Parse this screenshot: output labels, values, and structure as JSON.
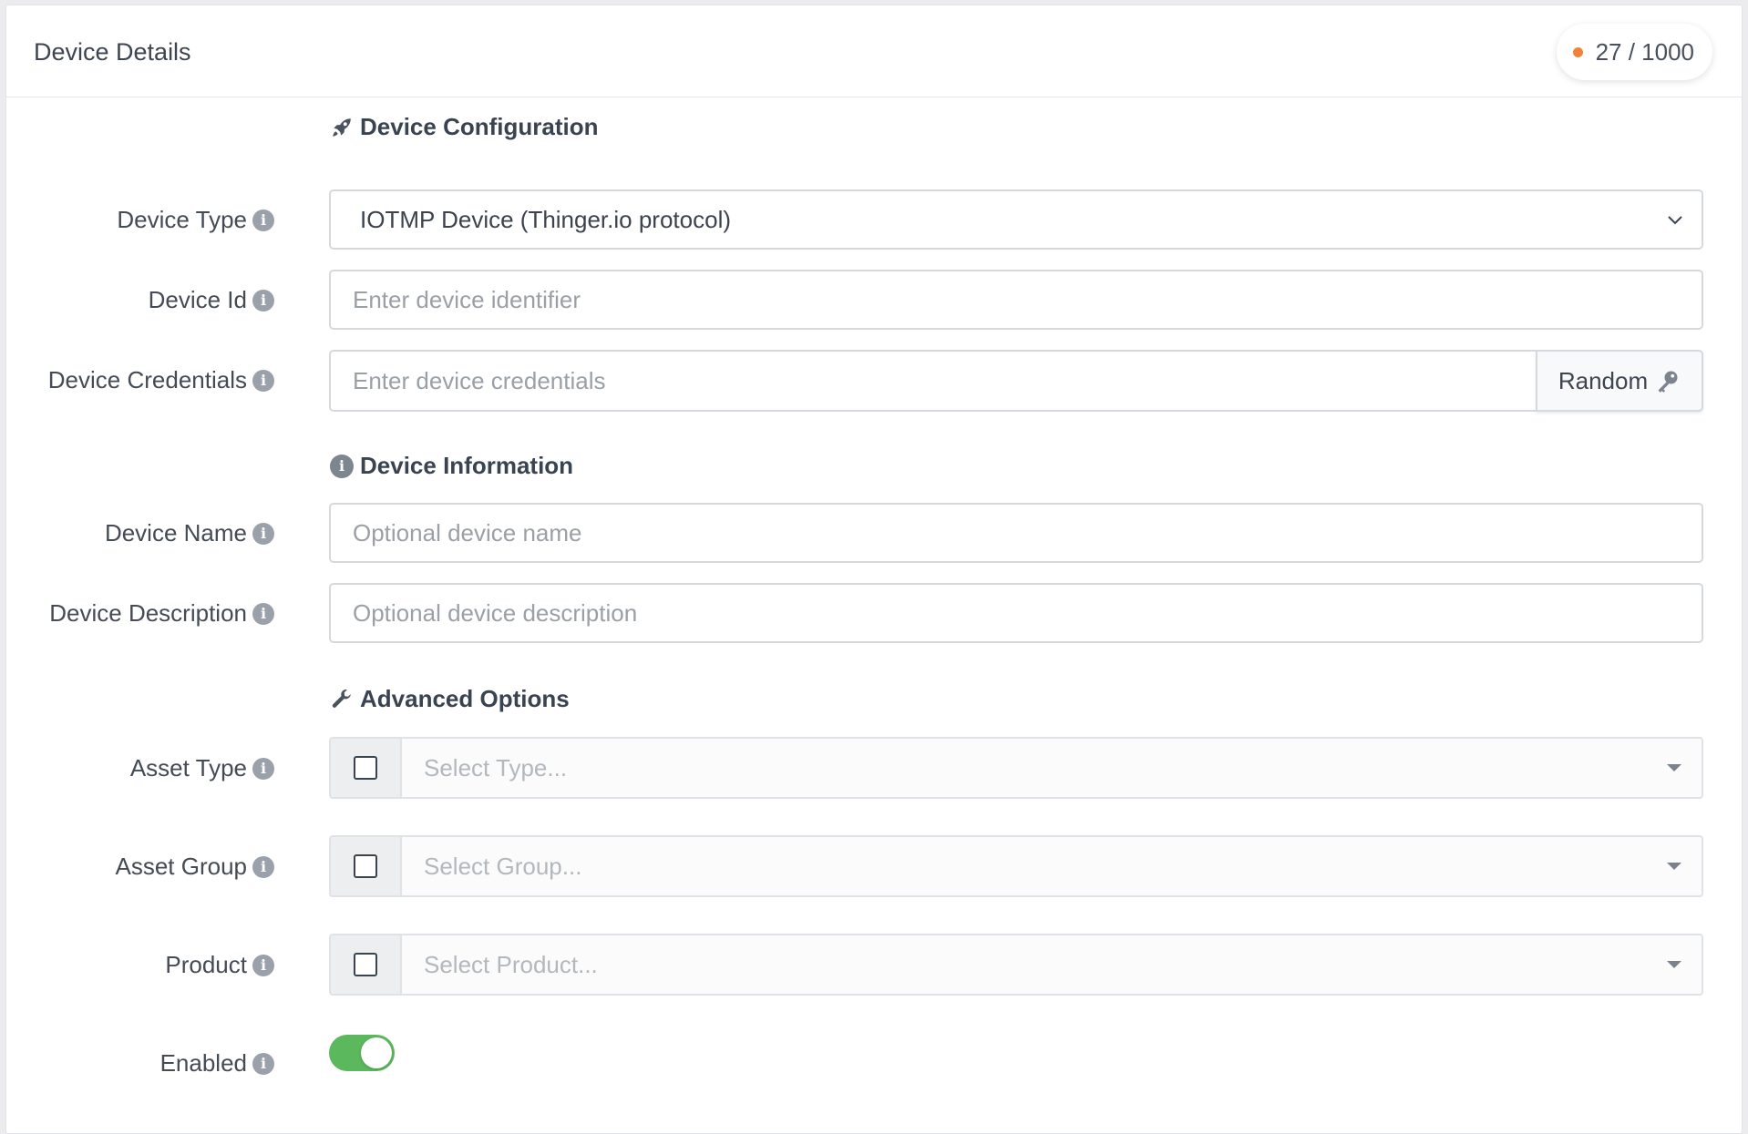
{
  "header": {
    "title": "Device Details",
    "quota": "27 / 1000",
    "quota_dot_color": "#f0823a"
  },
  "sections": {
    "configuration": "Device Configuration",
    "information": "Device Information",
    "advanced": "Advanced Options"
  },
  "fields": {
    "device_type": {
      "label": "Device Type",
      "value": "IOTMP Device (Thinger.io protocol)"
    },
    "device_id": {
      "label": "Device Id",
      "placeholder": "Enter device identifier",
      "value": ""
    },
    "device_credentials": {
      "label": "Device Credentials",
      "placeholder": "Enter device credentials",
      "value": "",
      "button": "Random"
    },
    "device_name": {
      "label": "Device Name",
      "placeholder": "Optional device name",
      "value": ""
    },
    "device_description": {
      "label": "Device Description",
      "placeholder": "Optional device description",
      "value": ""
    },
    "asset_type": {
      "label": "Asset Type",
      "placeholder": "Select Type..."
    },
    "asset_group": {
      "label": "Asset Group",
      "placeholder": "Select Group..."
    },
    "product": {
      "label": "Product",
      "placeholder": "Select Product..."
    },
    "enabled": {
      "label": "Enabled",
      "checked": true
    }
  },
  "icons": {
    "info": "info-icon",
    "rocket": "rocket-icon",
    "wrench": "wrench-icon",
    "key": "key-icon",
    "chevron": "chevron-down-icon",
    "caret": "caret-down-icon"
  },
  "colors": {
    "toggle_on": "#5cb85c",
    "info_icon": "#9aa1aa"
  }
}
